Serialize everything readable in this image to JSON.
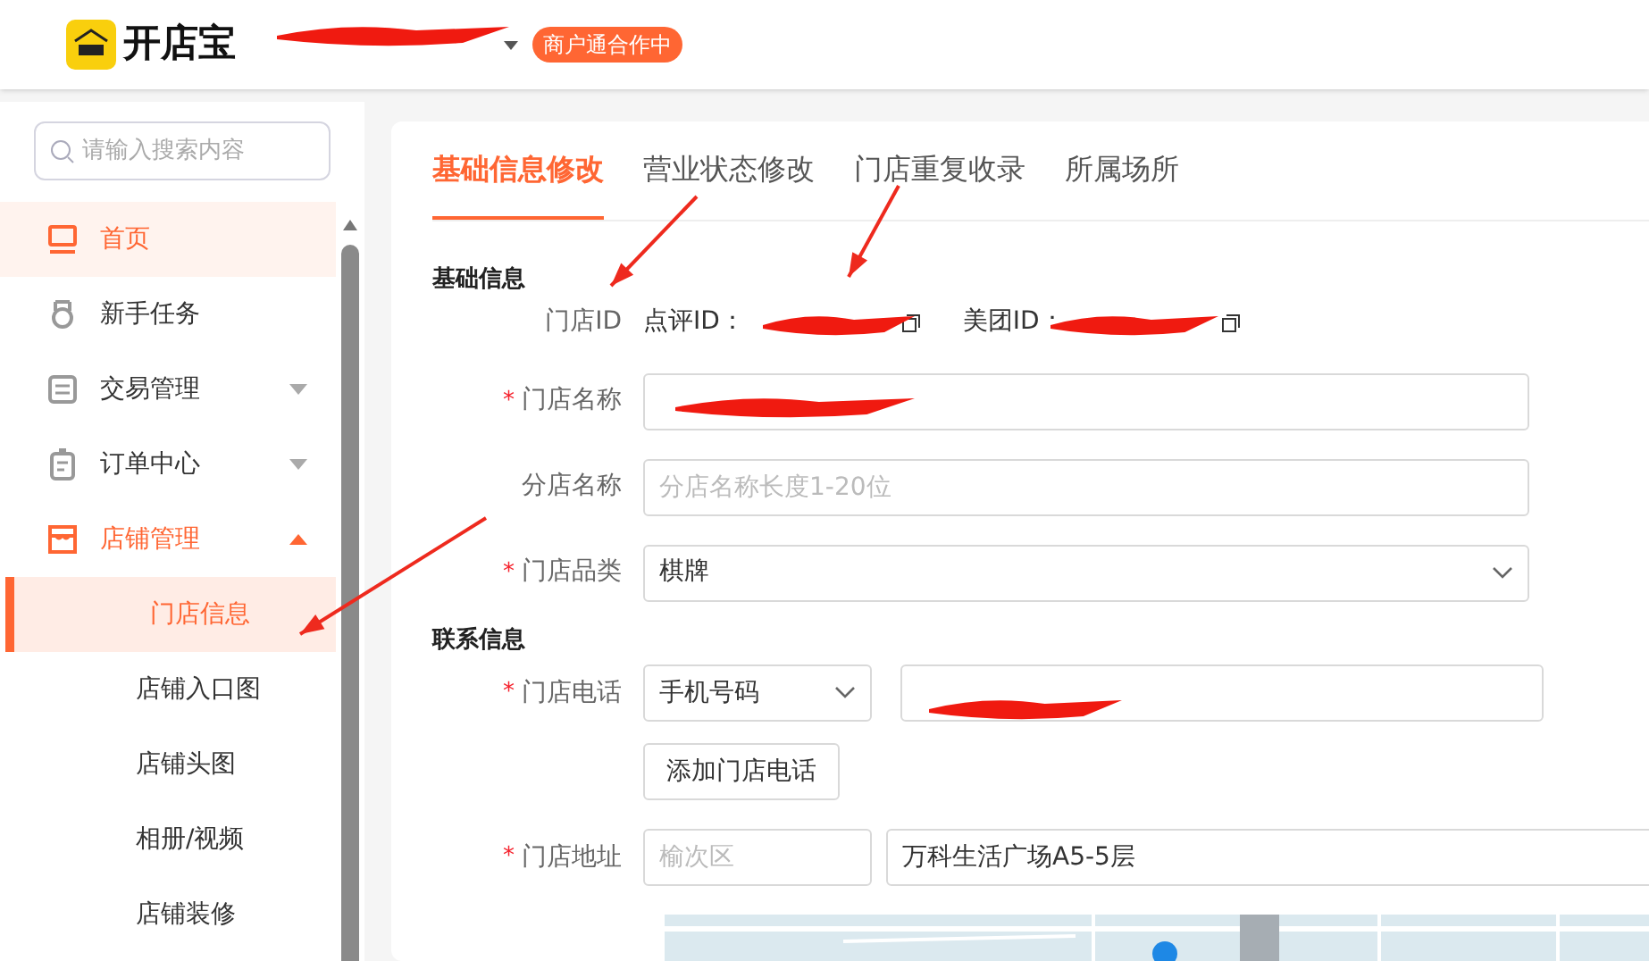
{
  "header": {
    "brand": "开店宝",
    "badge": "商户通合作中"
  },
  "sidebar": {
    "search": {
      "placeholder": "请输入搜索内容"
    },
    "items": [
      {
        "label": "首页",
        "kind": "link",
        "selected": true
      },
      {
        "label": "新手任务",
        "kind": "link",
        "selected": false
      },
      {
        "label": "交易管理",
        "kind": "group",
        "selected": false,
        "expanded": false
      },
      {
        "label": "订单中心",
        "kind": "group",
        "selected": false,
        "expanded": false
      },
      {
        "label": "店铺管理",
        "kind": "group",
        "selected": false,
        "expanded": true,
        "children": [
          {
            "label": "门店信息",
            "selected": true
          },
          {
            "label": "店铺入口图",
            "selected": false
          },
          {
            "label": "店铺头图",
            "selected": false
          },
          {
            "label": "相册/视频",
            "selected": false
          },
          {
            "label": "店铺装修",
            "selected": false
          }
        ]
      }
    ]
  },
  "tabs": [
    {
      "label": "基础信息修改",
      "selected": true
    },
    {
      "label": "营业状态修改",
      "selected": false
    },
    {
      "label": "门店重复收录",
      "selected": false
    },
    {
      "label": "所属场所",
      "selected": false
    }
  ],
  "sections": [
    {
      "title": "基础信息",
      "fields": [
        {
          "kind": "ids",
          "label": "门店ID",
          "ids": [
            "点评ID：",
            "美团ID："
          ]
        },
        {
          "kind": "text",
          "label": "门店名称",
          "required_mark": "*"
        },
        {
          "kind": "text",
          "label": "分店名称",
          "placeholder": "分店名称长度1-20位"
        },
        {
          "kind": "select",
          "label": "门店品类",
          "required_mark": "*",
          "value": "棋牌"
        }
      ]
    },
    {
      "title": "联系信息",
      "fields": [
        {
          "kind": "phone",
          "label": "门店电话",
          "required_mark": "*",
          "value": "手机号码",
          "button": "添加门店电话"
        },
        {
          "kind": "address",
          "label": "门店地址",
          "required_mark": "*",
          "district": "榆次区",
          "value": "万科生活广场A5-5层"
        }
      ]
    }
  ]
}
